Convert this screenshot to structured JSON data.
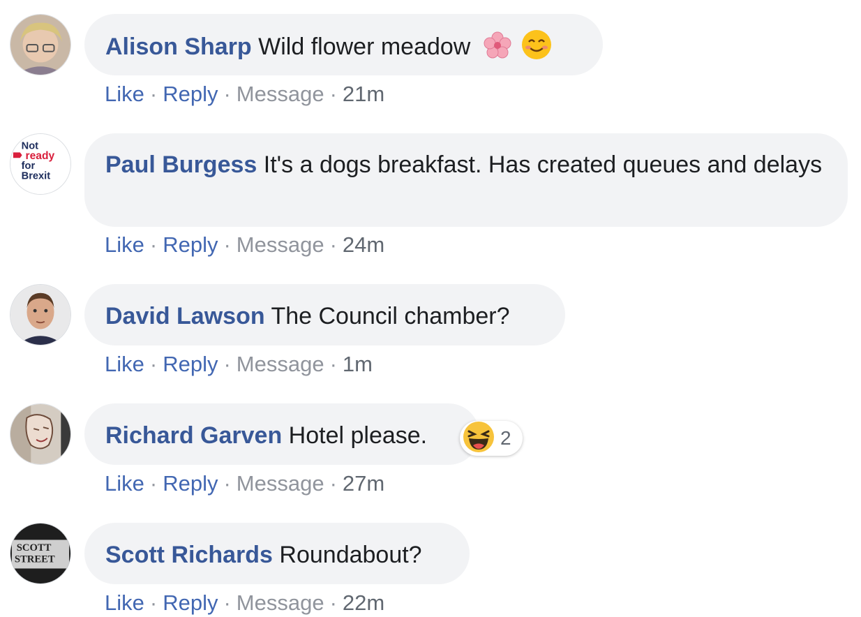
{
  "actions": {
    "like": "Like",
    "reply": "Reply",
    "message": "Message",
    "separator": "·"
  },
  "colors": {
    "author": "#385898",
    "link": "#4267b2",
    "muted": "#90949c",
    "bubble": "#f2f3f5"
  },
  "comments": [
    {
      "author": "Alison Sharp",
      "text": "Wild flower meadow",
      "time": "21m",
      "emojis": [
        "cherry-blossom-icon",
        "smiling-face-icon"
      ]
    },
    {
      "author": "Paul Burgess",
      "text": "It's a dogs breakfast. Has created queues and delays",
      "time": "24m",
      "avatar_text": [
        "Not",
        "ready",
        "for",
        "Brexit"
      ]
    },
    {
      "author": "David Lawson",
      "text": "The Council chamber?",
      "time": "1m"
    },
    {
      "author": "Richard Garven",
      "text": "Hotel please.",
      "time": "27m",
      "reaction": {
        "icon": "haha-reaction-icon",
        "count": "2"
      }
    },
    {
      "author": "Scott Richards",
      "text": "Roundabout?",
      "time": "22m",
      "avatar_text": [
        "SCOTT",
        "STREET"
      ]
    }
  ]
}
